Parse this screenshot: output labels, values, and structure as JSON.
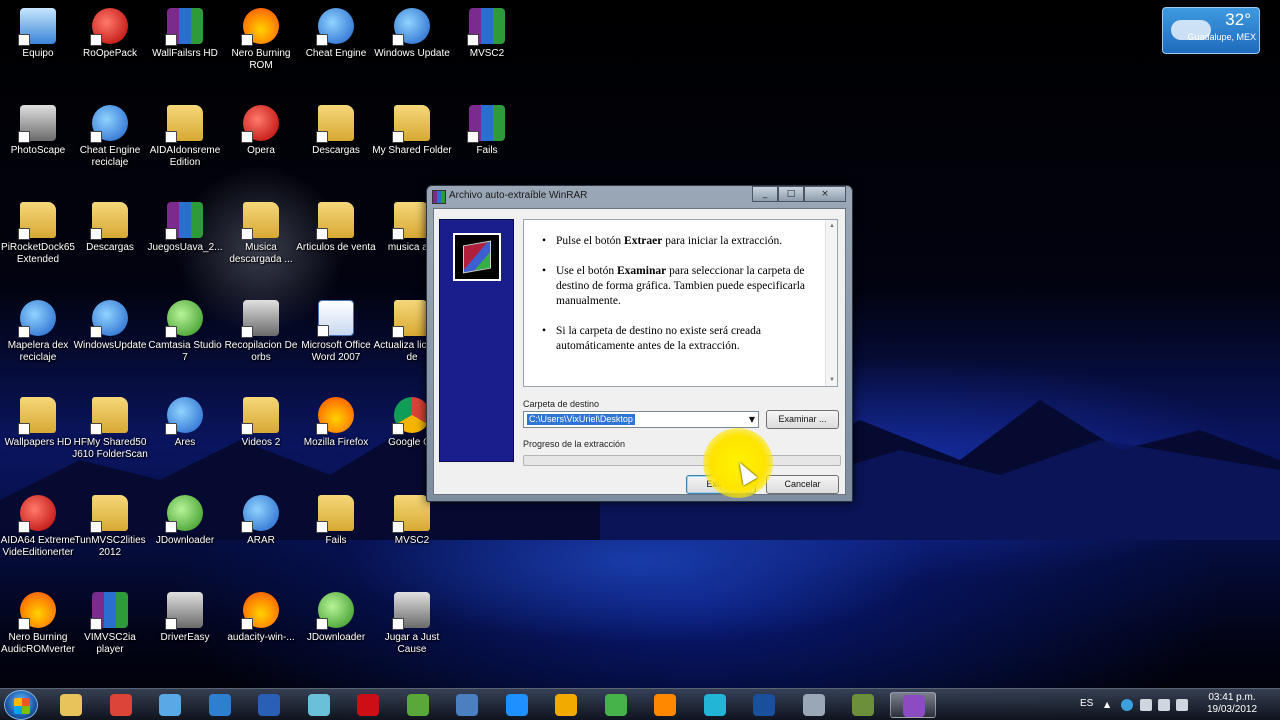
{
  "desktop": {
    "icons": [
      {
        "label": "Equipo",
        "style": "pc",
        "icon": "computer-icon"
      },
      {
        "label": "RoOpePack",
        "style": "red",
        "icon": "app-icon"
      },
      {
        "label": "WallFailsrs HD",
        "style": "winrar",
        "icon": "winrar-icon"
      },
      {
        "label": "Nero Burning ROM",
        "style": "fire",
        "icon": "nero-icon"
      },
      {
        "label": "Cheat Engine",
        "style": "blue",
        "icon": "cheat-engine-icon"
      },
      {
        "label": "Windows Update",
        "style": "blue",
        "icon": "windows-update-icon"
      },
      {
        "label": "MVSC2",
        "style": "winrar",
        "icon": "winrar-icon"
      },
      {
        "label": "PhotoScape",
        "style": "gray",
        "icon": "photoscape-icon"
      },
      {
        "label": "Cheat Engine reciclaje",
        "style": "blue",
        "icon": "cheat-engine-icon"
      },
      {
        "label": "AIDAIdonsreme Edition",
        "style": "folder",
        "icon": "folder-icon"
      },
      {
        "label": "Opera",
        "style": "red",
        "icon": "opera-icon"
      },
      {
        "label": "Descargas",
        "style": "folder",
        "icon": "folder-icon"
      },
      {
        "label": "My Shared Folder",
        "style": "folder",
        "icon": "folder-icon"
      },
      {
        "label": "Fails",
        "style": "winrar",
        "icon": "winrar-icon"
      },
      {
        "label": "PiRocketDock65 Extended",
        "style": "folder",
        "icon": "rocketdock-icon"
      },
      {
        "label": "Descargas",
        "style": "folder",
        "icon": "folder-icon"
      },
      {
        "label": "JuegosUava_2...",
        "style": "winrar",
        "icon": "winrar-icon"
      },
      {
        "label": "Musica descargada ...",
        "style": "folder",
        "icon": "folder-icon"
      },
      {
        "label": "Articulos de venta",
        "style": "folder",
        "icon": "folder-icon"
      },
      {
        "label": "musica a p",
        "style": "folder",
        "icon": "folder-icon"
      },
      {
        "label": "Mapelera dex reciclaje",
        "style": "blue",
        "icon": "recycle-bin-icon"
      },
      {
        "label": "WindowsUpdate",
        "style": "blue",
        "icon": "windows-update-icon"
      },
      {
        "label": "Camtasia Studio 7",
        "style": "green",
        "icon": "camtasia-icon"
      },
      {
        "label": "Recopilacion De orbs",
        "style": "gray",
        "icon": "archive-icon"
      },
      {
        "label": "Microsoft Office Word 2007",
        "style": "doc",
        "icon": "word-icon"
      },
      {
        "label": "Actualiza licencia de",
        "style": "folder",
        "icon": "cd-icon"
      },
      {
        "label": "Wallpapers HD",
        "style": "folder",
        "icon": "folder-icon"
      },
      {
        "label": "HFMy Shared50 J610 FolderScan",
        "style": "folder",
        "icon": "folder-icon"
      },
      {
        "label": "Ares",
        "style": "blue",
        "icon": "ares-icon"
      },
      {
        "label": "Videos 2",
        "style": "folder",
        "icon": "folder-icon"
      },
      {
        "label": "Mozilla Firefox",
        "style": "fire",
        "icon": "firefox-icon"
      },
      {
        "label": "Google Ch",
        "style": "chrome",
        "icon": "chrome-icon"
      },
      {
        "label": "AIDA64 Extreme VideEditionerter",
        "style": "red",
        "icon": "aida64-icon"
      },
      {
        "label": "TunMVSC2lities 2012",
        "style": "folder",
        "icon": "folder-icon"
      },
      {
        "label": "JDownloader",
        "style": "green",
        "icon": "jdownloader-icon"
      },
      {
        "label": "ARAR",
        "style": "blue",
        "icon": "tools-icon"
      },
      {
        "label": "Fails",
        "style": "folder",
        "icon": "folder-icon"
      },
      {
        "label": "MVSC2",
        "style": "folder",
        "icon": "folder-icon"
      },
      {
        "label": "Nero Burning AudicROMverter",
        "style": "fire",
        "icon": "nero-icon"
      },
      {
        "label": "VIMVSC2ia player",
        "style": "winrar",
        "icon": "winrar-icon"
      },
      {
        "label": "DriverEasy",
        "style": "gray",
        "icon": "drivereasy-icon"
      },
      {
        "label": "audacity-win-...",
        "style": "fire",
        "icon": "audacity-icon"
      },
      {
        "label": "JDownloader",
        "style": "green",
        "icon": "jdownloader-icon"
      },
      {
        "label": "Jugar a Just Cause",
        "style": "gray",
        "icon": "game-icon"
      }
    ]
  },
  "weather": {
    "temp": "32°",
    "location": "Guadalupe, MEX"
  },
  "dialog": {
    "title": "Archivo auto-extraíble WinRAR",
    "minimize": "_",
    "maximize": "□",
    "close": "×",
    "instructions": [
      {
        "prefix": "Pulse el botón ",
        "bold": "Extraer",
        "suffix": " para iniciar la extracción."
      },
      {
        "prefix": "Use el botón ",
        "bold": "Examinar",
        "suffix": " para seleccionar la carpeta de destino de forma gráfica. Tambien puede especificarla manualmente."
      },
      {
        "prefix": "",
        "bold": "",
        "suffix": "Si la carpeta de destino no existe será creada automáticamente antes de la extracción."
      }
    ],
    "dest_label": "Carpeta de destino",
    "dest_value": "C:\\Users\\VixUriel\\Desktop",
    "browse_label": "Examinar ...",
    "progress_label": "Progreso de la extracción",
    "progress_value": 0,
    "extract_label": "Extraer",
    "cancel_label": "Cancelar"
  },
  "taskbar": {
    "language": "ES",
    "time": "03:41 p.m.",
    "date": "19/03/2012",
    "apps": [
      {
        "name": "explorer-icon",
        "color": "#e8c25a"
      },
      {
        "name": "chrome-icon",
        "color": "#db4437"
      },
      {
        "name": "messenger-icon",
        "color": "#5aa9e6"
      },
      {
        "name": "ares-icon",
        "color": "#2f7fd0"
      },
      {
        "name": "word-icon",
        "color": "#2a5fb8"
      },
      {
        "name": "camtasia-icon",
        "color": "#6ac0d8"
      },
      {
        "name": "opera-icon",
        "color": "#cc0f16"
      },
      {
        "name": "jdownloader-icon",
        "color": "#5aa83a"
      },
      {
        "name": "cheat-engine-icon",
        "color": "#4a7fc0"
      },
      {
        "name": "ie-icon",
        "color": "#1e90ff"
      },
      {
        "name": "media-icon",
        "color": "#f2a900"
      },
      {
        "name": "music-icon",
        "color": "#46b24a"
      },
      {
        "name": "vlc-icon",
        "color": "#ff8800"
      },
      {
        "name": "circle-icon",
        "color": "#22b5d6"
      },
      {
        "name": "photoshop-icon",
        "color": "#1a4f9c"
      },
      {
        "name": "display-icon",
        "color": "#9aa7b6"
      },
      {
        "name": "game-icon",
        "color": "#6b8f3a"
      },
      {
        "name": "winrar-icon",
        "color": "#8a4cc0"
      }
    ]
  }
}
